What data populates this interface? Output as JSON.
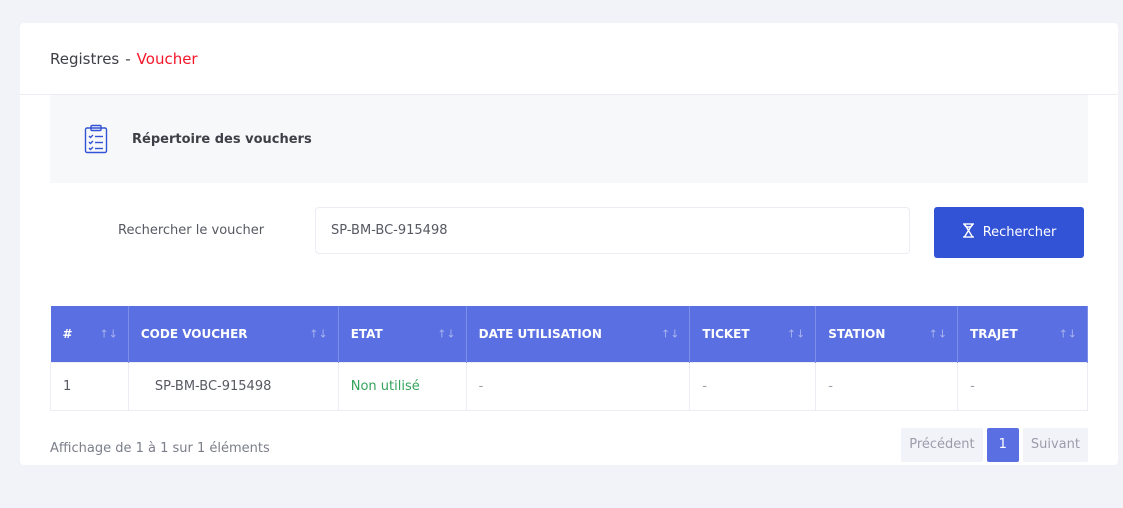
{
  "header": {
    "title_main": "Registres",
    "title_sep": "-",
    "title_accent": "Voucher"
  },
  "info": {
    "title": "Répertoire des vouchers",
    "icon": "clipboard-list-icon"
  },
  "search": {
    "label": "Rechercher le voucher",
    "value": "SP-BM-BC-915498",
    "button_label": "Rechercher",
    "button_icon": "hourglass-icon"
  },
  "table": {
    "columns": [
      "#",
      "CODE VOUCHER",
      "ETAT",
      "DATE UTILISATION",
      "TICKET",
      "STATION",
      "TRAJET"
    ],
    "rows": [
      [
        "1",
        "SP-BM-BC-915498",
        "Non utilisé",
        "-",
        "-",
        "-",
        "-"
      ]
    ]
  },
  "footer": {
    "info": "Affichage de 1 à 1 sur 1 éléments",
    "prev": "Précédent",
    "page": "1",
    "next": "Suivant"
  },
  "colors": {
    "accent": "#f4162a",
    "primary": "#3353d6",
    "table_header": "#5a6fe1",
    "status_green": "#34a35b"
  }
}
